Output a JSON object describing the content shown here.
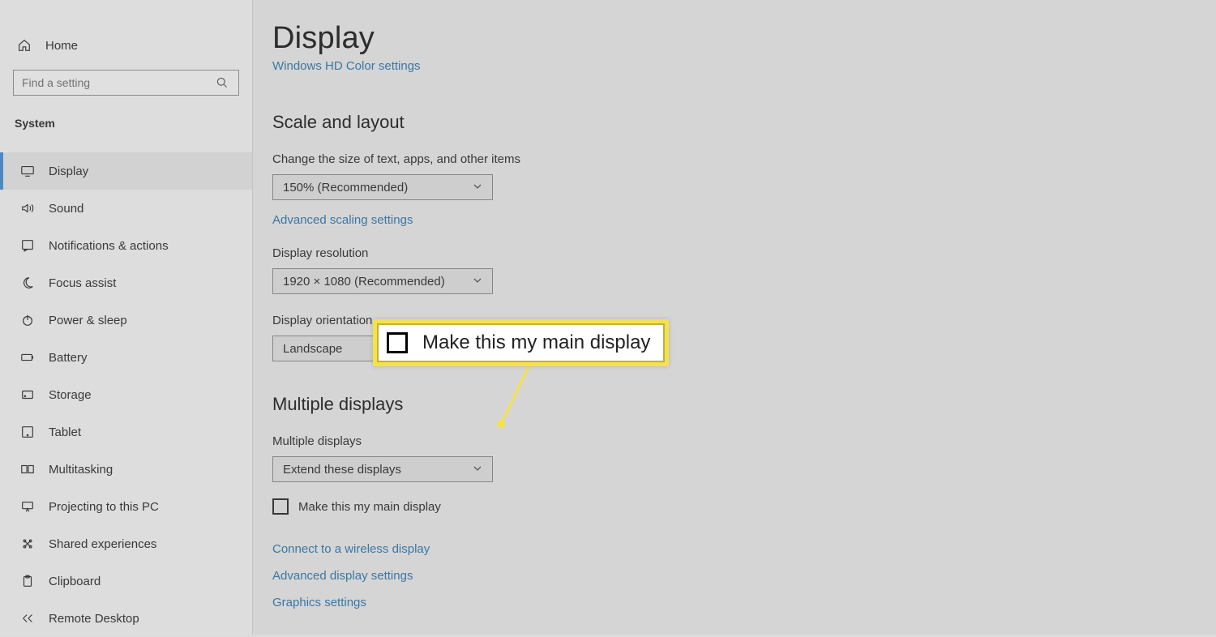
{
  "sidebar": {
    "home": {
      "label": "Home"
    },
    "search": {
      "placeholder": "Find a setting"
    },
    "section_label": "System",
    "items": [
      {
        "label": "Display",
        "icon": "display-icon",
        "active": true
      },
      {
        "label": "Sound",
        "icon": "sound-icon",
        "active": false
      },
      {
        "label": "Notifications & actions",
        "icon": "notifications-icon",
        "active": false
      },
      {
        "label": "Focus assist",
        "icon": "focus-assist-icon",
        "active": false
      },
      {
        "label": "Power & sleep",
        "icon": "power-icon",
        "active": false
      },
      {
        "label": "Battery",
        "icon": "battery-icon",
        "active": false
      },
      {
        "label": "Storage",
        "icon": "storage-icon",
        "active": false
      },
      {
        "label": "Tablet",
        "icon": "tablet-icon",
        "active": false
      },
      {
        "label": "Multitasking",
        "icon": "multitasking-icon",
        "active": false
      },
      {
        "label": "Projecting to this PC",
        "icon": "projecting-icon",
        "active": false
      },
      {
        "label": "Shared experiences",
        "icon": "shared-experiences-icon",
        "active": false
      },
      {
        "label": "Clipboard",
        "icon": "clipboard-icon",
        "active": false
      },
      {
        "label": "Remote Desktop",
        "icon": "remote-desktop-icon",
        "active": false
      }
    ]
  },
  "main": {
    "title": "Display",
    "cut_off_link": "Windows HD Color settings",
    "scale_section": {
      "heading": "Scale and layout",
      "text_size_label": "Change the size of text, apps, and other items",
      "text_size_value": "150% (Recommended)",
      "advanced_scaling_link": "Advanced scaling settings",
      "resolution_label": "Display resolution",
      "resolution_value": "1920 × 1080 (Recommended)",
      "orientation_label": "Display orientation",
      "orientation_value": "Landscape"
    },
    "multiple_section": {
      "heading": "Multiple displays",
      "mode_label": "Multiple displays",
      "mode_value": "Extend these displays",
      "main_display_checkbox_label": "Make this my main display",
      "connect_wireless_link": "Connect to a wireless display",
      "advanced_display_link": "Advanced display settings",
      "graphics_link": "Graphics settings"
    }
  },
  "callout": {
    "label": "Make this my main display"
  }
}
